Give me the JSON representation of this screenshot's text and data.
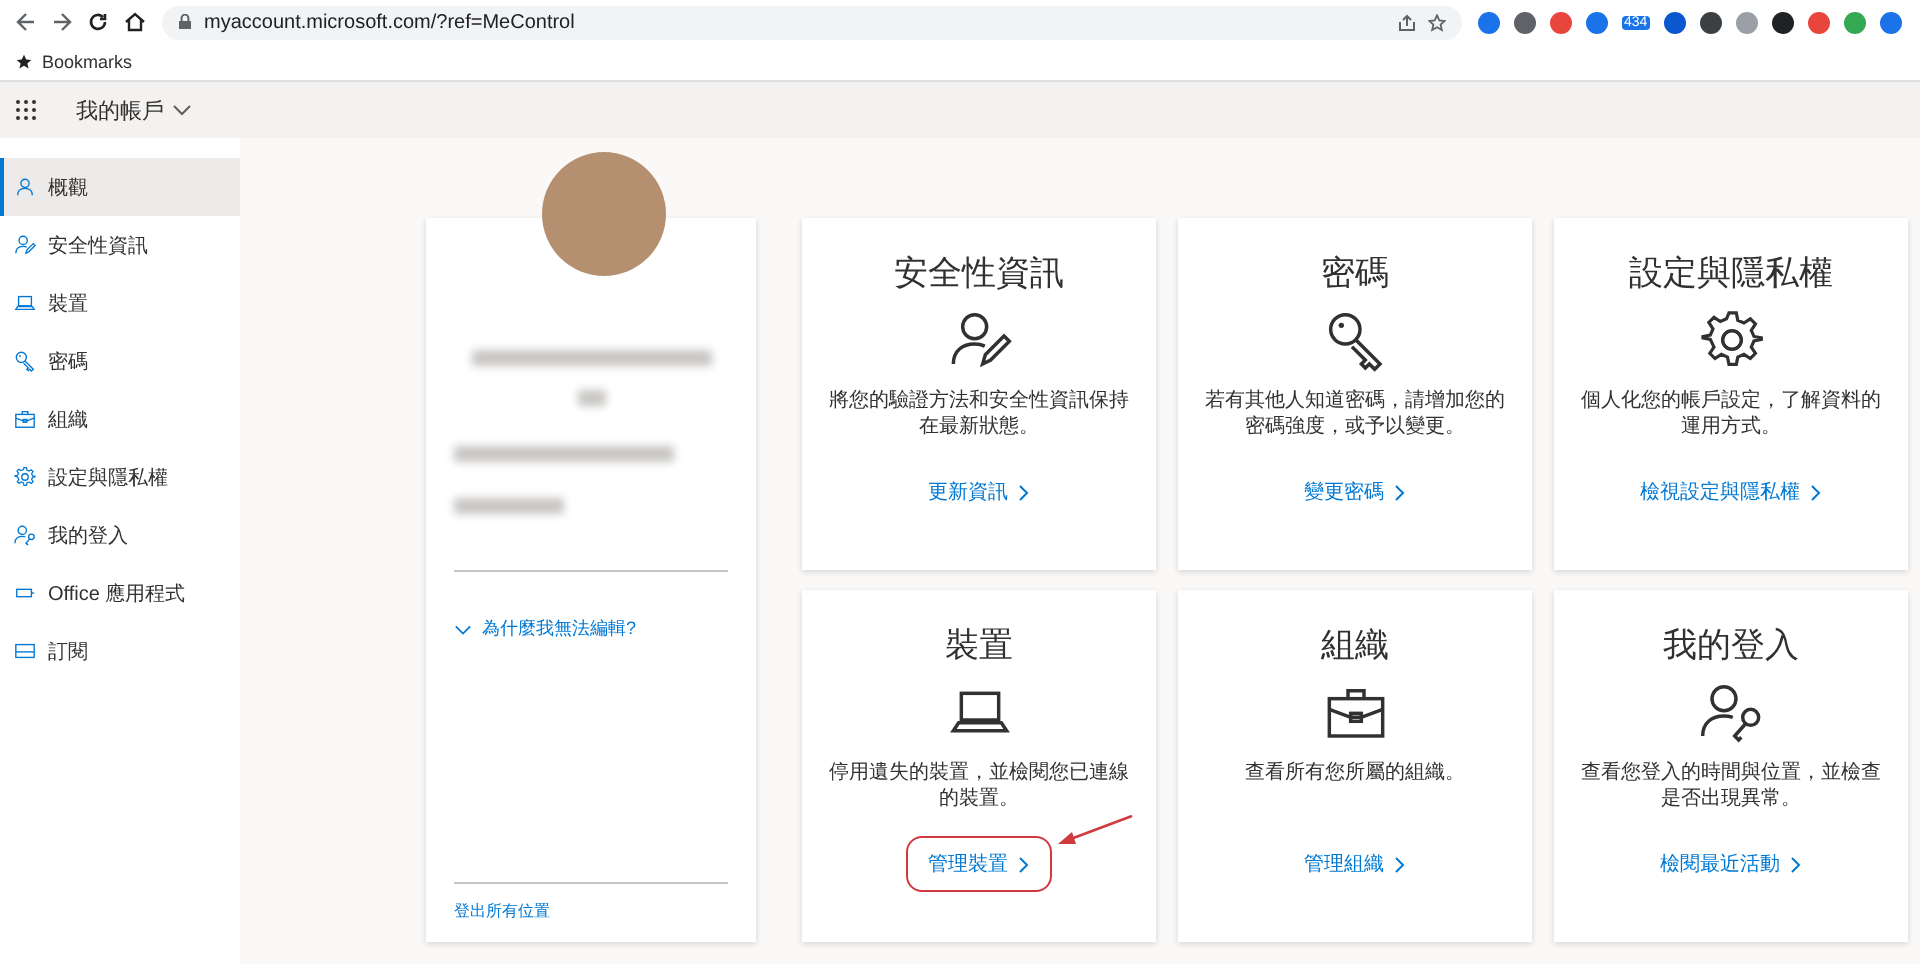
{
  "browser": {
    "url": "myaccount.microsoft.com/?ref=MeControl",
    "extension_badge": "434",
    "bookmarks_label": "Bookmarks"
  },
  "header": {
    "title": "我的帳戶"
  },
  "sidebar": {
    "items": [
      {
        "label": "概觀",
        "kind": "person",
        "selected": true
      },
      {
        "label": "安全性資訊",
        "kind": "person-edit",
        "selected": false
      },
      {
        "label": "裝置",
        "kind": "laptop",
        "selected": false
      },
      {
        "label": "密碼",
        "kind": "key",
        "selected": false
      },
      {
        "label": "組織",
        "kind": "briefcase",
        "selected": false
      },
      {
        "label": "設定與隱私權",
        "kind": "gear",
        "selected": false
      },
      {
        "label": "我的登入",
        "kind": "person-key",
        "selected": false
      },
      {
        "label": "Office 應用程式",
        "kind": "apps",
        "selected": false
      },
      {
        "label": "訂閱",
        "kind": "card",
        "selected": false
      }
    ]
  },
  "profile": {
    "why_link": "為什麼我無法編輯?",
    "sign_out_link": "登出所有位置"
  },
  "cards": [
    {
      "title": "安全性資訊",
      "kind": "person-edit",
      "description": "將您的驗證方法和安全性資訊保持在最新狀態。",
      "link": "更新資訊",
      "highlighted": false
    },
    {
      "title": "密碼",
      "kind": "key",
      "description": "若有其他人知道密碼，請增加您的密碼強度，或予以變更。",
      "link": "變更密碼",
      "highlighted": false
    },
    {
      "title": "設定與隱私權",
      "kind": "gear",
      "description": "個人化您的帳戶設定，了解資料的運用方式。",
      "link": "檢視設定與隱私權",
      "highlighted": false
    },
    {
      "title": "裝置",
      "kind": "laptop",
      "description": "停用遺失的裝置，並檢閱您已連線的裝置。",
      "link": "管理裝置",
      "highlighted": true
    },
    {
      "title": "組織",
      "kind": "briefcase",
      "description": "查看所有您所屬的組織。",
      "link": "管理組織",
      "highlighted": false
    },
    {
      "title": "我的登入",
      "kind": "person-key",
      "description": "查看您登入的時間與位置，並檢查是否出現異常。",
      "link": "檢閱最近活動",
      "highlighted": false
    }
  ]
}
